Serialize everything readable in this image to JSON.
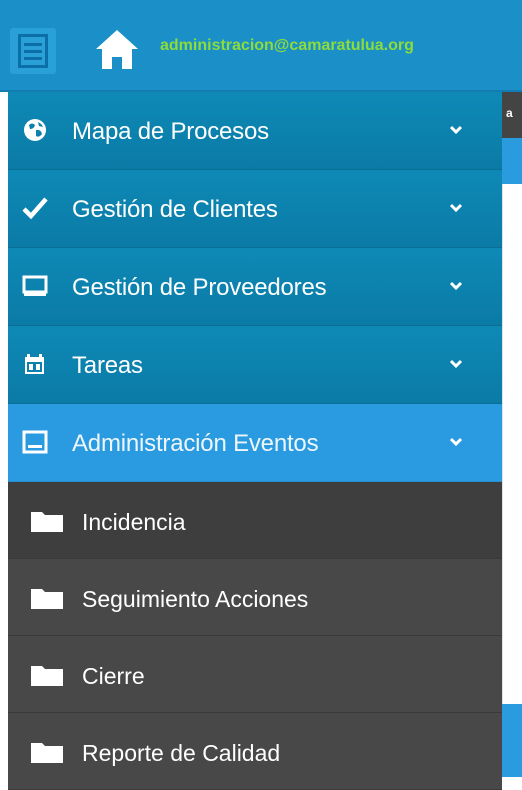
{
  "header": {
    "email": "administracion@camaratulua.org"
  },
  "background": {
    "peek_text": "a"
  },
  "sidebar": {
    "items": [
      {
        "label": "Mapa de Procesos",
        "icon": "globe-icon"
      },
      {
        "label": "Gestión de Clientes",
        "icon": "check-icon"
      },
      {
        "label": "Gestión de Proveedores",
        "icon": "monitor-icon"
      },
      {
        "label": "Tareas",
        "icon": "calendar-icon"
      },
      {
        "label": "Administración Eventos",
        "icon": "window-icon"
      }
    ],
    "subitems": [
      {
        "label": "Incidencia",
        "icon": "folder-icon"
      },
      {
        "label": "Seguimiento Acciones",
        "icon": "folder-icon"
      },
      {
        "label": "Cierre",
        "icon": "folder-icon"
      },
      {
        "label": "Reporte de Calidad",
        "icon": "folder-icon"
      }
    ]
  },
  "colors": {
    "topbar": "#1a8fc8",
    "nav_item": "#0e89b6",
    "nav_active": "#2a9be0",
    "submenu": "#484848",
    "email_text": "#8ddc38"
  }
}
